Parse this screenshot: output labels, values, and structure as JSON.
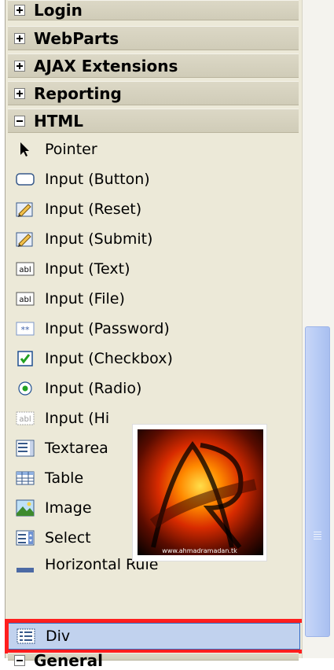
{
  "caption": "div",
  "categories": {
    "login": "Login",
    "webparts": "WebParts",
    "ajax": "AJAX Extensions",
    "reporting": "Reporting",
    "html": "HTML",
    "general": "General"
  },
  "items": [
    {
      "label": "Pointer",
      "icon": "pointer-icon"
    },
    {
      "label": "Input (Button)",
      "icon": "button-icon"
    },
    {
      "label": "Input (Reset)",
      "icon": "reset-icon"
    },
    {
      "label": "Input (Submit)",
      "icon": "submit-icon"
    },
    {
      "label": "Input (Text)",
      "icon": "textbox-icon",
      "icon_text": "abl"
    },
    {
      "label": "Input (File)",
      "icon": "file-icon",
      "icon_text": "abl"
    },
    {
      "label": "Input (Password)",
      "icon": "password-icon",
      "icon_text": "**"
    },
    {
      "label": "Input (Checkbox)",
      "icon": "checkbox-icon"
    },
    {
      "label": "Input (Radio)",
      "icon": "radio-icon"
    },
    {
      "label": "Input (Hi",
      "icon": "hidden-icon",
      "icon_text": "abl"
    },
    {
      "label": "Textarea",
      "icon": "textarea-icon"
    },
    {
      "label": "Table",
      "icon": "table-icon"
    },
    {
      "label": "Image",
      "icon": "image-icon"
    },
    {
      "label": "Select",
      "icon": "select-icon"
    },
    {
      "label": "Horizontal Rule",
      "icon": "horizontal-rule-icon"
    },
    {
      "label": "Div",
      "icon": "div-icon",
      "selected": true
    }
  ],
  "logo": {
    "text": "AR",
    "url": "www.ahmadramadan.tk"
  },
  "colors": {
    "highlight": "#ff1e1e",
    "selection": "#c1d2ee"
  }
}
